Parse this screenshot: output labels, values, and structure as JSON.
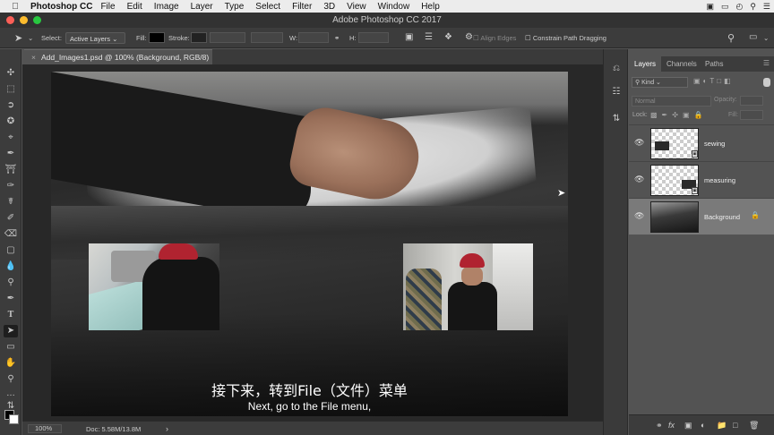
{
  "menubar": {
    "app": "Photoshop CC",
    "items": [
      "File",
      "Edit",
      "Image",
      "Layer",
      "Type",
      "Select",
      "Filter",
      "3D",
      "View",
      "Window",
      "Help"
    ]
  },
  "window": {
    "title": "Adobe Photoshop CC 2017"
  },
  "options": {
    "select_label": "Select:",
    "select_value": "Active Layers",
    "fill_label": "Fill:",
    "stroke_label": "Stroke:",
    "w_label": "W:",
    "h_label": "H:",
    "align_edges": "Align Edges",
    "constrain": "Constrain Path Dragging"
  },
  "document": {
    "tab_title": "Add_Images1.psd @ 100% (Background, RGB/8)"
  },
  "subtitle": {
    "cn": "接下来，转到File（文件）菜单",
    "en": "Next, go to the File menu,"
  },
  "status": {
    "zoom": "100%",
    "doc": "Doc: 5.58M/13.8M"
  },
  "layers_panel": {
    "tabs": [
      "Layers",
      "Channels",
      "Paths"
    ],
    "kind_label": "Kind",
    "blend_mode": "Normal",
    "opacity_label": "Opacity:",
    "lock_label": "Lock:",
    "fill_label": "Fill:",
    "layers": [
      {
        "name": "sewing"
      },
      {
        "name": "measuring"
      },
      {
        "name": "Background"
      }
    ]
  },
  "colors": {
    "accent_red": "#fc5f57",
    "accent_yellow": "#fdbc2e",
    "accent_green": "#28c840",
    "panel_bg": "#535353",
    "selected_layer": "#7a7a7a"
  }
}
